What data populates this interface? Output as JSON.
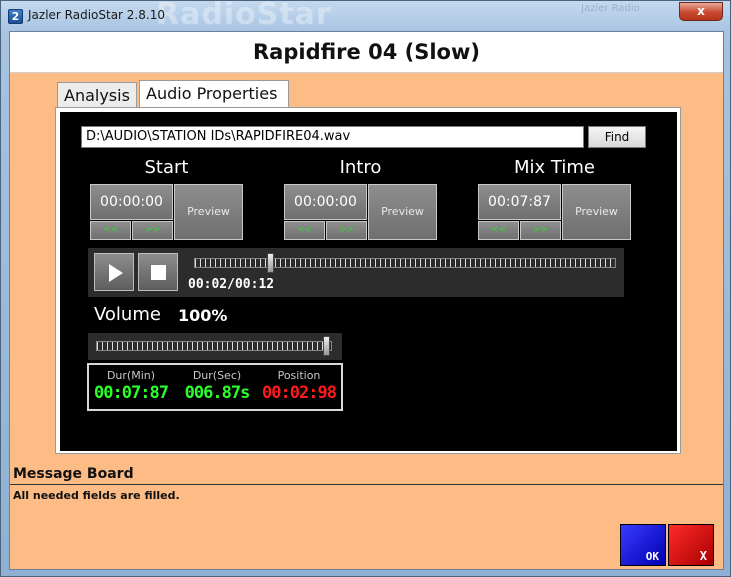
{
  "window": {
    "title": "Jazler RadioStar 2.8.10",
    "watermark": "RadioStar",
    "watermark_right": "Jazler Radio",
    "icon_letter": "2",
    "close_label": "x"
  },
  "header": {
    "title": "Rapidfire 04 (Slow)"
  },
  "tabs": [
    {
      "label": "Analysis"
    },
    {
      "label": "Audio Properties"
    }
  ],
  "file": {
    "path": "D:\\AUDIO\\STATION IDs\\RAPIDFIRE04.wav",
    "find_label": "Find"
  },
  "cue_points": [
    {
      "label": "Start",
      "time": "00:00:00",
      "preview_label": "Preview",
      "nudge_back": "<<",
      "nudge_fwd": ">>"
    },
    {
      "label": "Intro",
      "time": "00:00:00",
      "preview_label": "Preview",
      "nudge_back": "<<",
      "nudge_fwd": ">>"
    },
    {
      "label": "Mix Time",
      "time": "00:07:87",
      "preview_label": "Preview",
      "nudge_back": "<<",
      "nudge_fwd": ">>"
    }
  ],
  "transport": {
    "time_readout": "00:02/00:12",
    "position_fraction": 0.18
  },
  "volume": {
    "label": "Volume",
    "value": "100%",
    "level_fraction": 1.0
  },
  "stats": [
    {
      "label": "Dur(Min)",
      "value": "00:07:87",
      "color": "#2bff2b"
    },
    {
      "label": "Dur(Sec)",
      "value": "006.87s",
      "color": "#2bff2b"
    },
    {
      "label": "Position",
      "value": "00:02:98",
      "color": "#ff1a1a"
    }
  ],
  "message_board": {
    "title": "Message Board",
    "text": "All needed fields are filled."
  },
  "buttons": {
    "ok_label": "OK",
    "cancel_label": "X"
  },
  "colors": {
    "accent": "#fdbb86",
    "ok": "#0000d0",
    "cancel": "#d00000"
  }
}
